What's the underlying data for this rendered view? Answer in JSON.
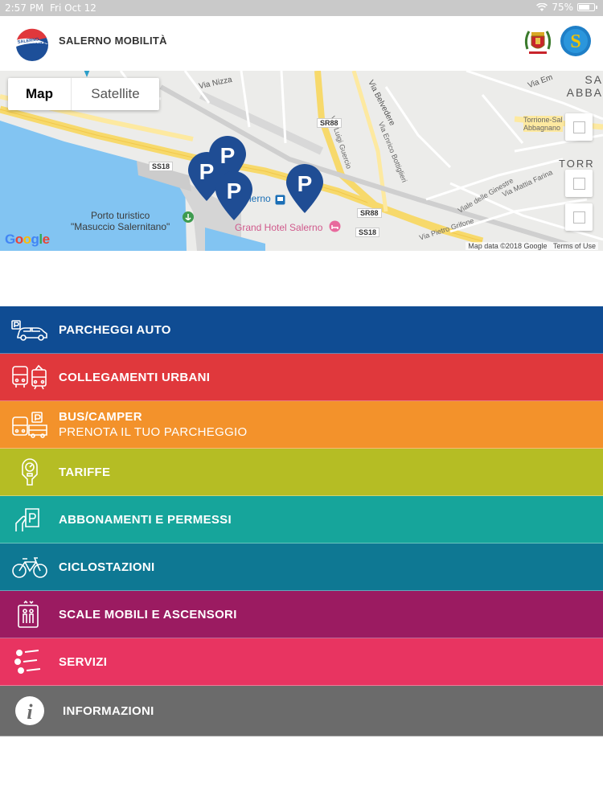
{
  "status_bar": {
    "time": "2:57 PM",
    "date": "Fri Oct 12",
    "battery": "75%",
    "battery_level": 0.75
  },
  "header": {
    "title": "SALERNO MOBILITÀ",
    "logo_text": "SALERNO MOBILITÀ",
    "s_logo_letter": "S"
  },
  "map": {
    "type_control": {
      "map_label": "Map",
      "satellite_label": "Satellite",
      "selected": "Map"
    },
    "labels": {
      "via_nizza": "Via Nizza",
      "via_belvedere": "Via Belvedere",
      "via_luigi_guercio": "Via Luigi Guercio",
      "via_enrico_bottiglieri": "Via Enrico Bottiglieri",
      "via_em": "Via Em",
      "sa_abba": "SA\nABBA",
      "torre": "TORR",
      "torrione": "Torrione-Sal\nAbbagnano",
      "viale_ginestre": "Viale delle Ginestre",
      "via_mattia_farina": "Via Mattia Farina",
      "via_pietro_grifone": "Via Pietro Grifone",
      "porto": "Porto turistico\n\"Masuccio Salernitano\"",
      "salerno_station": "lerno",
      "grand_hotel": "Grand Hotel Salerno",
      "ss18_a": "SS18",
      "ss18_b": "SS18",
      "sr88_a": "SR88",
      "sr88_b": "SR88"
    },
    "pins": [
      "P",
      "P",
      "P",
      "P"
    ],
    "google_brand": "Google",
    "map_data": "Map data ©2018 Google",
    "terms": "Terms of Use"
  },
  "menu": [
    {
      "label": "PARCHEGGI AUTO",
      "color": "#0f4c93",
      "icon": "car-parking-icon"
    },
    {
      "label": "COLLEGAMENTI URBANI",
      "color": "#e0383c",
      "icon": "bus-train-icon"
    },
    {
      "label": "BUS/CAMPER",
      "sublabel": "PRENOTA IL TUO PARCHEGGIO",
      "color": "#f3922b",
      "icon": "bus-camper-icon"
    },
    {
      "label": "TARIFFE",
      "color": "#b5bd24",
      "icon": "parking-meter-icon"
    },
    {
      "label": "ABBONAMENTI E PERMESSI",
      "color": "#16a59b",
      "icon": "permit-card-icon"
    },
    {
      "label": "CICLOSTAZIONI",
      "color": "#0e7893",
      "icon": "bicycle-icon"
    },
    {
      "label": "SCALE MOBILI E ASCENSORI",
      "color": "#9b1b61",
      "icon": "elevator-icon"
    },
    {
      "label": "SERVIZI",
      "color": "#e83461",
      "icon": "list-icon"
    },
    {
      "label": "INFORMAZIONI",
      "color": "#6b6b6b",
      "icon": "info-icon"
    }
  ]
}
